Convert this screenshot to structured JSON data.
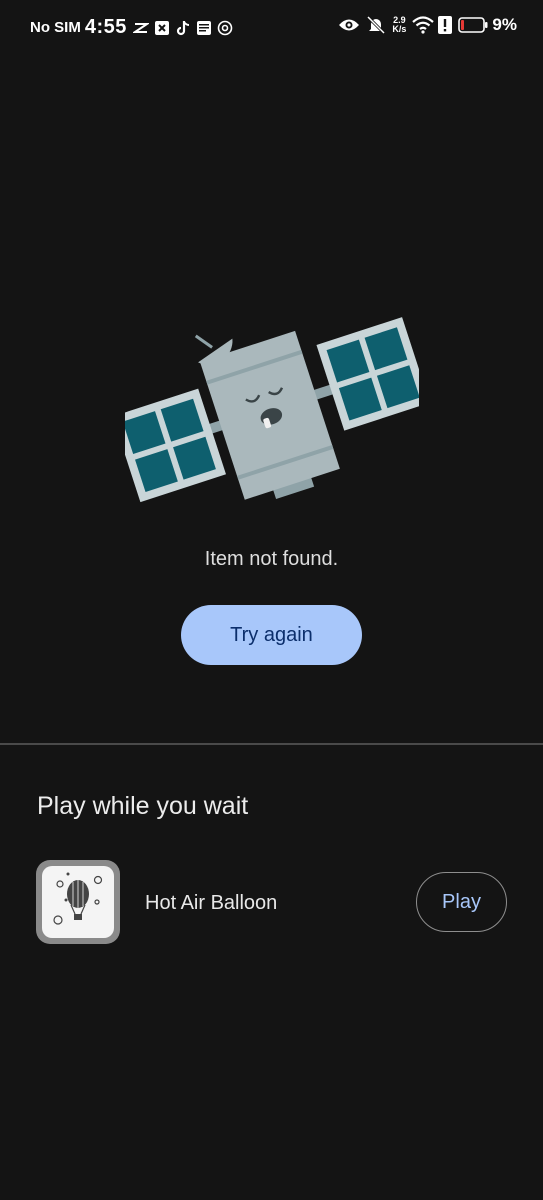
{
  "status_bar": {
    "carrier": "No SIM",
    "time": "4:55",
    "net_speed_value": "2.9",
    "net_speed_unit": "K/s",
    "battery": "9%",
    "left_icons": [
      "capcut-icon",
      "app-icon",
      "tiktok-icon",
      "notes-icon",
      "counter-icon"
    ],
    "right_icons": [
      "eye-icon",
      "mute-bell-icon",
      "wifi-icon",
      "alert-icon",
      "battery-icon"
    ]
  },
  "error": {
    "illustration": "sleeping-satellite-illustration",
    "message": "Item not found.",
    "retry_label": "Try again"
  },
  "play_section": {
    "title": "Play while you wait",
    "games": [
      {
        "name": "Hot Air Balloon",
        "icon": "hot-air-balloon-icon",
        "action_label": "Play"
      }
    ]
  },
  "colors": {
    "background": "#141414",
    "accent": "#a8c7fa",
    "panel": "#0e5f6e",
    "satellite_body": "#aab8bc"
  }
}
